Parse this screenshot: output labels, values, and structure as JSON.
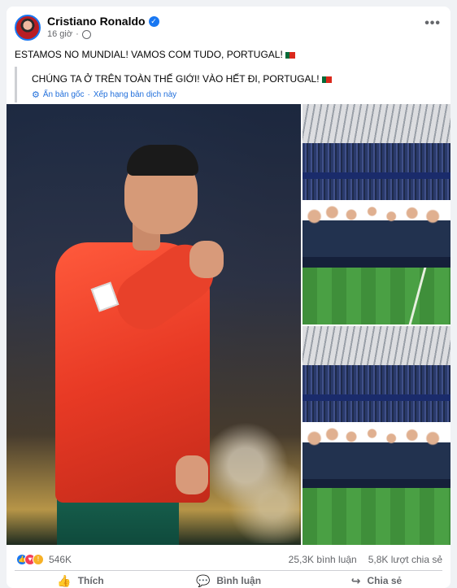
{
  "post": {
    "author": "Cristiano Ronaldo",
    "time": "16 giờ",
    "more_label": "•••",
    "text": "ESTAMOS NO MUNDIAL! VAMOS COM TUDO, PORTUGAL!",
    "translation": {
      "text": "CHÚNG TA Ở TRÊN TOÀN THẾ GIỚI! VÀO HẾT ĐI, PORTUGAL!",
      "hide_original": "Ẩn bản gốc",
      "separator": "·",
      "rate": "Xếp hạng bản dịch này"
    }
  },
  "stats": {
    "reactions": "546K",
    "comments": "25,3K bình luận",
    "shares": "5,8K lượt chia sẻ"
  },
  "actions": {
    "like": "Thích",
    "comment": "Bình luận",
    "share": "Chia sẻ"
  },
  "icons": {
    "verified": "verified-badge-icon",
    "privacy": "globe-icon",
    "translate": "gear-icon",
    "like": "thumbs-up-icon",
    "comment": "speech-bubble-icon",
    "share": "share-arrow-icon"
  },
  "colors": {
    "accent": "#1877f2",
    "link": "#216fdb",
    "muted": "#65676b"
  }
}
